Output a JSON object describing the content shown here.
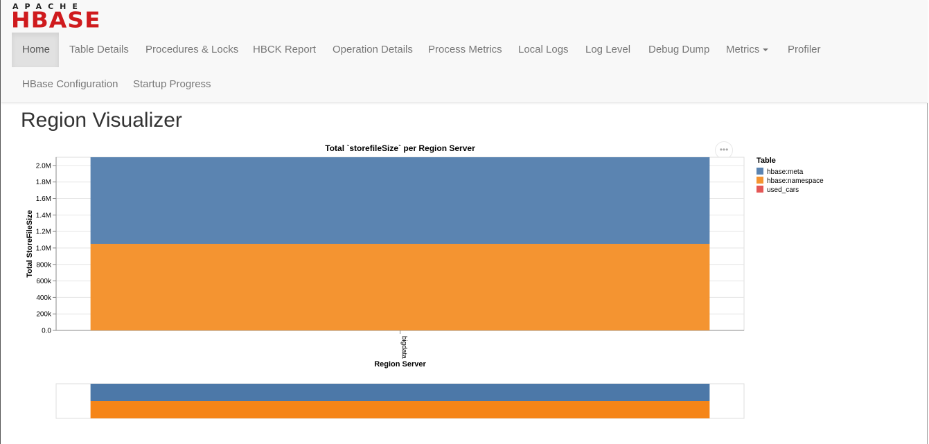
{
  "brand": {
    "top": "APACHE",
    "name": "HBASE"
  },
  "nav": {
    "row1": [
      "Home",
      "Table Details",
      "Procedures & Locks",
      "HBCK Report",
      "Operation Details",
      "Process Metrics",
      "Local Logs",
      "Log Level",
      "Debug Dump",
      "Metrics",
      "Profiler"
    ],
    "row2": [
      "HBase Configuration",
      "Startup Progress"
    ],
    "active": "Home"
  },
  "page": {
    "title": "Region Visualizer"
  },
  "chart_menu_label": "•••",
  "legend": {
    "title": "Table",
    "items": [
      {
        "name": "hbase:meta",
        "color": "#5b84b1"
      },
      {
        "name": "hbase:namespace",
        "color": "#f49431"
      },
      {
        "name": "used_cars",
        "color": "#e45756"
      }
    ]
  },
  "chart_data": {
    "type": "bar",
    "stacked": true,
    "title": "Total `storefileSize` per Region Server",
    "xlabel": "Region Server",
    "ylabel": "Total StoreFileSize",
    "categories": [
      "bigdata"
    ],
    "series": [
      {
        "name": "hbase:namespace",
        "values": [
          1050000
        ]
      },
      {
        "name": "hbase:meta",
        "values": [
          1050000
        ]
      },
      {
        "name": "used_cars",
        "values": [
          0
        ]
      }
    ],
    "yticks": [
      "0.0",
      "200k",
      "400k",
      "600k",
      "800k",
      "1.0M",
      "1.2M",
      "1.4M",
      "1.6M",
      "1.8M",
      "2.0M"
    ],
    "ylim": [
      0,
      2100000
    ],
    "grid": true,
    "legend_position": "right",
    "overview": true
  }
}
